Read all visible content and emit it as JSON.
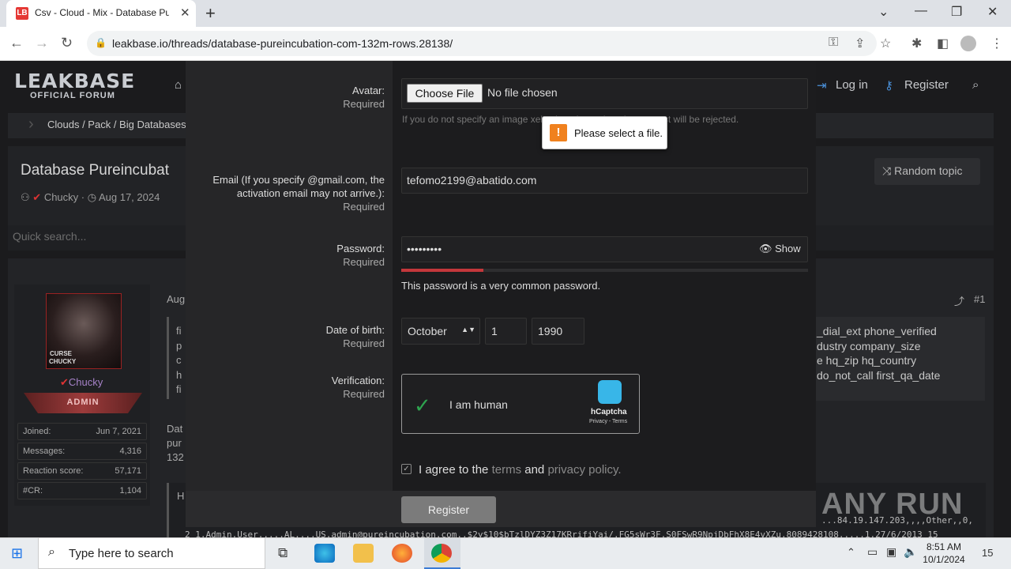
{
  "browser": {
    "tab_title": "Csv - Cloud - Mix - Database Pu",
    "url": "leakbase.io/threads/database-pureincubation-com-132m-rows.28138/"
  },
  "site": {
    "logo": "LEAKBASE",
    "logo_sub": "OFFICIAL FORUM",
    "login": "Log in",
    "register": "Register",
    "breadcrumb": "Clouds / Pack / Big Databases",
    "thread_title": "Database Pureincubat",
    "author": "Chucky",
    "date": "Aug 17, 2024",
    "random_topic": "Random topic",
    "quick_search": "Quick search...",
    "post_date": "Aug",
    "post_num": "#1"
  },
  "user": {
    "name": "Chucky",
    "role": "ADMIN",
    "avatar_text": "CURSE CHUCKY",
    "stats": [
      {
        "k": "Joined:",
        "v": "Jun 7, 2021"
      },
      {
        "k": "Messages:",
        "v": "4,316"
      },
      {
        "k": "Reaction score:",
        "v": "57,171"
      },
      {
        "k": "#CR:",
        "v": "1,104"
      }
    ]
  },
  "post": {
    "right_lines": [
      "_dial_ext phone_verified",
      "dustry company_size",
      "e hq_zip hq_country",
      "do_not_call first_qa_date"
    ],
    "left_frag": [
      "fi",
      "p",
      "c",
      "h",
      "fi"
    ],
    "body_frag": [
      "Dat",
      "pur",
      "132"
    ],
    "code_prefix": "H",
    "code_line1": "...84.19.147.203,,,,Other,,0,",
    "code_line2": "2   1,Admin,User,...,AL,..,US,admin@pureincubation.com,,$2y$10$bTzlDYZ3Z17KRrifiYai/.FG5sWr3F.S0FSwR9NpjDbFhX8E4vXZu,8089428108,...,1,27/6/2013 15"
  },
  "form": {
    "avatar_label": "Avatar:",
    "required": "Required",
    "choose_file": "Choose File",
    "no_file": "No file chosen",
    "avatar_hint": "If you do not specify an image                                                         xels, then the registration request will be rejected.",
    "tooltip": "Please select a file.",
    "email_label": "Email (If you specify @gmail.com, the activation email may not arrive.):",
    "email_value": "tefomo2199@abatido.com",
    "password_label": "Password:",
    "password_value": "•••••••••",
    "show": "Show",
    "password_msg": "This password is a very common password.",
    "dob_label": "Date of birth:",
    "month": "October",
    "day": "1",
    "year": "1990",
    "verif_label": "Verification:",
    "captcha_text": "I am human",
    "hcaptcha": "hCaptcha",
    "hcaptcha_links": "Privacy - Terms",
    "agree_pre": "I agree to the",
    "terms": "terms",
    "and": "and",
    "privacy": "privacy policy.",
    "register_btn": "Register"
  },
  "watermark": "ANY RUN",
  "taskbar": {
    "search_placeholder": "Type here to search",
    "time": "8:51 AM",
    "date": "10/1/2024"
  },
  "colors": {
    "accent_pw": "#c3373b",
    "captcha_check": "#2ea44f"
  }
}
